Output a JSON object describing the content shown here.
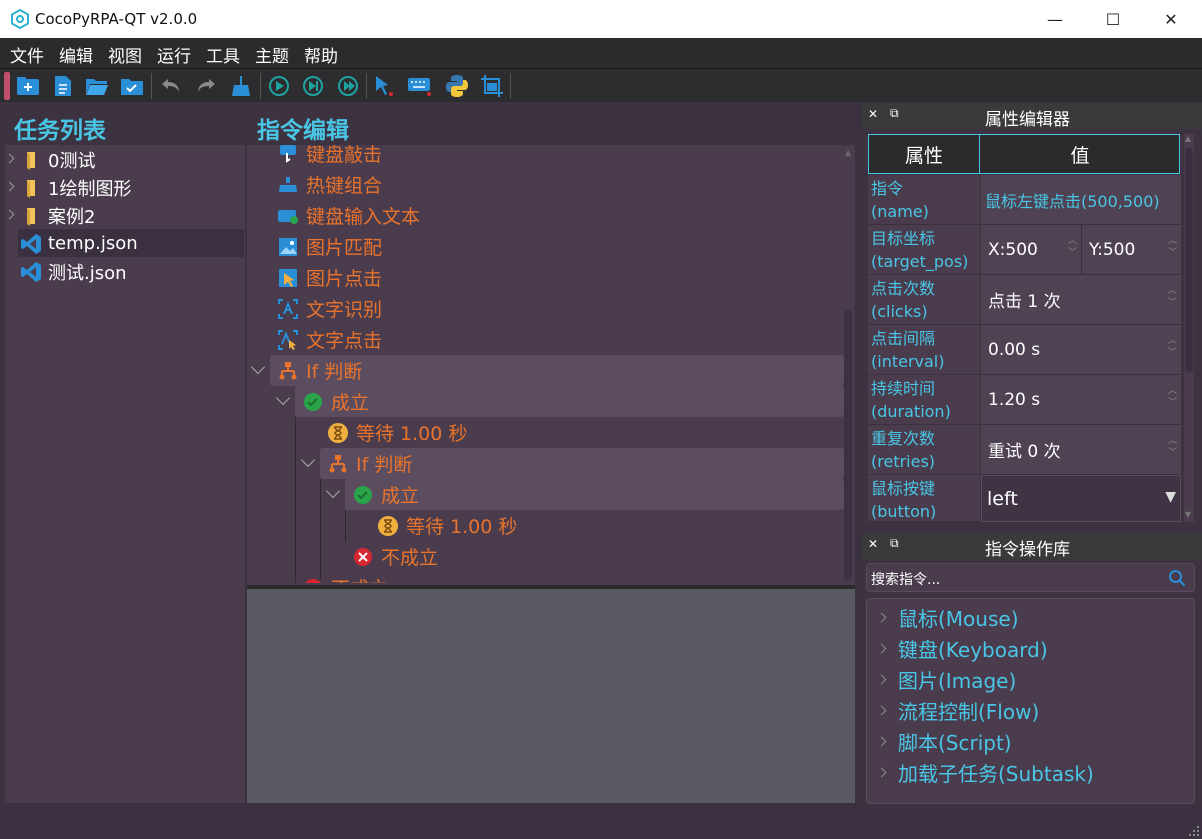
{
  "window": {
    "title": "CocoPyRPA-QT v2.0.0",
    "minimize": "—",
    "maximize": "☐",
    "close": "✕"
  },
  "menu": [
    "文件",
    "编辑",
    "视图",
    "运行",
    "工具",
    "主题",
    "帮助"
  ],
  "toolbar_icons": [
    "new-task-icon",
    "new-file-icon",
    "open-folder-icon",
    "save-folder-icon",
    "undo-icon",
    "redo-icon",
    "clear-icon",
    "run-icon",
    "run-step-icon",
    "run-to-icon",
    "pick-element-icon",
    "keyboard-record-icon",
    "python-icon",
    "screenshot-icon"
  ],
  "task_list": {
    "title": "任务列表",
    "items": [
      {
        "label": "0测试",
        "type": "folder"
      },
      {
        "label": "1绘制图形",
        "type": "folder"
      },
      {
        "label": "案例2",
        "type": "folder"
      },
      {
        "label": "temp.json",
        "type": "file",
        "selected": true
      },
      {
        "label": "测试.json",
        "type": "file"
      }
    ]
  },
  "editor": {
    "title": "指令编辑",
    "commands": [
      {
        "label": "键盘敲击",
        "icon": "keyboard-tap-icon"
      },
      {
        "label": "热键组合",
        "icon": "hotkey-icon"
      },
      {
        "label": "键盘输入文本",
        "icon": "keyboard-text-icon"
      },
      {
        "label": "图片匹配",
        "icon": "image-match-icon"
      },
      {
        "label": "图片点击",
        "icon": "image-click-icon"
      },
      {
        "label": "文字识别",
        "icon": "text-recognize-icon"
      },
      {
        "label": "文字点击",
        "icon": "text-click-icon"
      },
      {
        "label": "If 判断",
        "icon": "branch-icon"
      },
      {
        "label": "成立",
        "icon": "check-icon"
      },
      {
        "label": "等待 1.00 秒",
        "icon": "hourglass-icon"
      },
      {
        "label": "If 判断",
        "icon": "branch-icon"
      },
      {
        "label": "成立",
        "icon": "check-icon"
      },
      {
        "label": "等待 1.00 秒",
        "icon": "hourglass-icon"
      },
      {
        "label": "不成立",
        "icon": "cross-icon"
      },
      {
        "label": "不成立",
        "icon": "cross-icon"
      }
    ]
  },
  "properties": {
    "title": "属性编辑器",
    "col_name": "属性",
    "col_value": "值",
    "rows": [
      {
        "name": "指令",
        "key": "(name)",
        "value": "鼠标左键点击(500,500)"
      },
      {
        "name": "目标坐标",
        "key": "(target_pos)",
        "x": "X:500",
        "y": "Y:500"
      },
      {
        "name": "点击次数",
        "key": "(clicks)",
        "value": "点击 1 次"
      },
      {
        "name": "点击间隔",
        "key": "(interval)",
        "value": "0.00 s"
      },
      {
        "name": "持续时间",
        "key": "(duration)",
        "value": "1.20 s"
      },
      {
        "name": "重复次数",
        "key": "(retries)",
        "value": "重试 0 次"
      },
      {
        "name": "鼠标按键",
        "key": "(button)",
        "value": "left"
      }
    ]
  },
  "library": {
    "title": "指令操作库",
    "search_placeholder": "搜索指令...",
    "items": [
      "鼠标(Mouse)",
      "键盘(Keyboard)",
      "图片(Image)",
      "流程控制(Flow)",
      "脚本(Script)",
      "加载子任务(Subtask)"
    ]
  },
  "colors": {
    "accent": "#49c6e5",
    "command": "#e8732c",
    "panel": "#4a3c4d",
    "success": "#2aa44a",
    "fail": "#d6262f",
    "wait": "#f0b040"
  }
}
